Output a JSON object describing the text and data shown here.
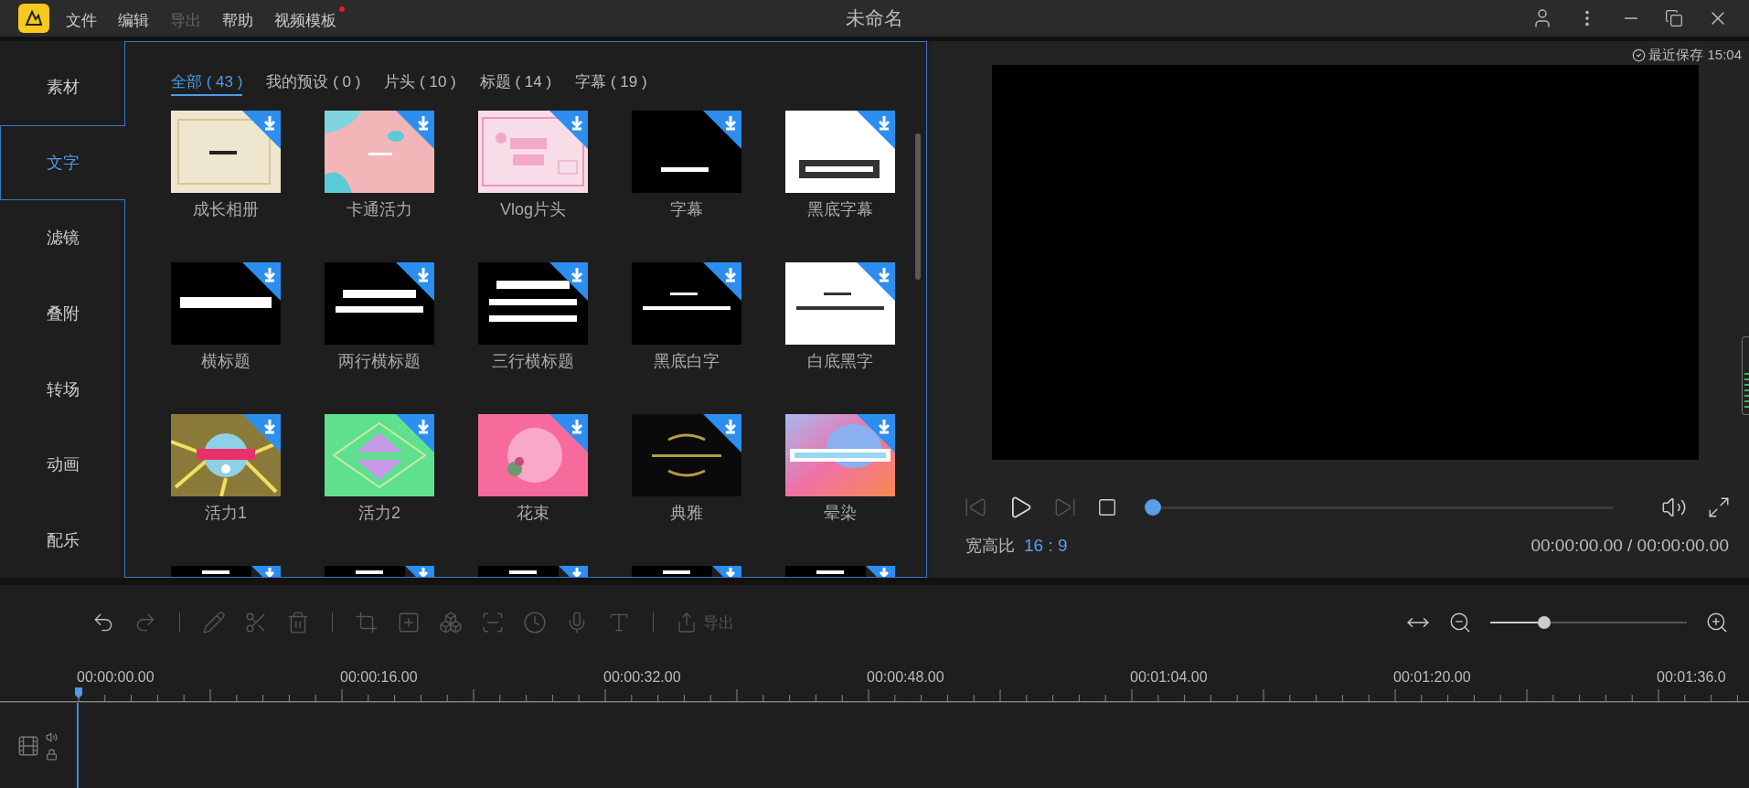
{
  "menu": [
    {
      "label": "文件",
      "disabled": false,
      "dot": false
    },
    {
      "label": "编辑",
      "disabled": false,
      "dot": false
    },
    {
      "label": "导出",
      "disabled": true,
      "dot": false
    },
    {
      "label": "帮助",
      "disabled": false,
      "dot": false
    },
    {
      "label": "视频模板",
      "disabled": false,
      "dot": true
    }
  ],
  "window": {
    "title": "未命名"
  },
  "sidebar": {
    "items": [
      {
        "label": "素材",
        "selected": false
      },
      {
        "label": "文字",
        "selected": true
      },
      {
        "label": "滤镜",
        "selected": false
      },
      {
        "label": "叠附",
        "selected": false
      },
      {
        "label": "转场",
        "selected": false
      },
      {
        "label": "动画",
        "selected": false
      },
      {
        "label": "配乐",
        "selected": false
      }
    ]
  },
  "tabs": [
    {
      "label": "全部 ( 43 )",
      "selected": true
    },
    {
      "label": "我的预设 ( 0 )",
      "selected": false
    },
    {
      "label": "片头 ( 10 )",
      "selected": false
    },
    {
      "label": "标题 ( 14 )",
      "selected": false
    },
    {
      "label": "字幕 ( 19 )",
      "selected": false
    }
  ],
  "templates": [
    {
      "kind": "template",
      "label": "成长相册"
    },
    {
      "kind": "template",
      "label": "卡通活力"
    },
    {
      "kind": "template",
      "label": "Vlog片头"
    },
    {
      "kind": "template",
      "label": "字幕"
    },
    {
      "kind": "template",
      "label": "黑底字幕"
    },
    {
      "kind": "template",
      "label": "横标题"
    },
    {
      "kind": "template",
      "label": "两行横标题"
    },
    {
      "kind": "template",
      "label": "三行横标题"
    },
    {
      "kind": "template",
      "label": "黑底白字"
    },
    {
      "kind": "template",
      "label": "白底黑字"
    },
    {
      "kind": "template",
      "label": "活力1"
    },
    {
      "kind": "template",
      "label": "活力2"
    },
    {
      "kind": "template",
      "label": "花束"
    },
    {
      "kind": "template",
      "label": "典雅"
    },
    {
      "kind": "template",
      "label": "晕染"
    },
    {
      "kind": "picture"
    },
    {
      "kind": "picture"
    },
    {
      "kind": "picture"
    },
    {
      "kind": "picture"
    },
    {
      "kind": "picture"
    }
  ],
  "preview": {
    "save_status": "最近保存 15:04",
    "progress": {
      "level": 0
    },
    "aspect_label": "宽高比",
    "aspect_value": "16 : 9",
    "time": "00:00:00.00 / 00:00:00.00"
  },
  "toolbar": {
    "tools": [
      {
        "disabled": false
      },
      {
        "disabled": true
      },
      {
        "disabled": true
      },
      {
        "disabled": true
      },
      {
        "disabled": true
      },
      {
        "disabled": true
      },
      {
        "disabled": true
      },
      {
        "disabled": true
      },
      {
        "disabled": true
      },
      {
        "disabled": true
      },
      {
        "disabled": true
      },
      {
        "disabled": true
      }
    ],
    "export": {
      "label": "导出",
      "disabled": true
    },
    "zoom": {
      "level": 0.26
    }
  },
  "ruler": [
    "00:00:00.00",
    "00:00:16.00",
    "00:00:32.00",
    "00:00:48.00",
    "00:01:04.00",
    "00:01:20.00",
    "00:01:36.0"
  ]
}
